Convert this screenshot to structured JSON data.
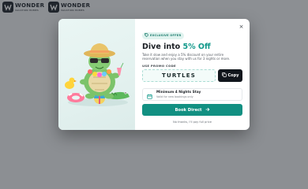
{
  "site": {
    "logo_name": "WONDER",
    "logo_sub": "VACATION HOMES"
  },
  "modal": {
    "badge": "EXCLUSIVE OFFER",
    "headline_prefix": "Dive into ",
    "headline_accent": "5% Off",
    "description": "Take it slow and enjoy a 5% discount on your entire reservation when you stay with us for 3 nights or more.",
    "promo_label": "USE PROMO CODE",
    "promo_code": "TURTLES",
    "copy_label": "Copy",
    "condition_title": "Minimum 4 Nights Stay",
    "condition_sub": "Valid for new bookings only",
    "book_label": "Book Direct",
    "dismiss_label": "No thanks, I'll pay full price",
    "close_symbol": "×"
  },
  "icons": {
    "badge": "tag-icon",
    "copy": "copy-icon",
    "condition": "calendar-icon",
    "book": "arrow-right-icon",
    "close": "close-icon",
    "illustration": "turtle-illustration"
  },
  "colors": {
    "accent": "#10988a",
    "button": "#129082",
    "copy_button": "#11161c"
  }
}
